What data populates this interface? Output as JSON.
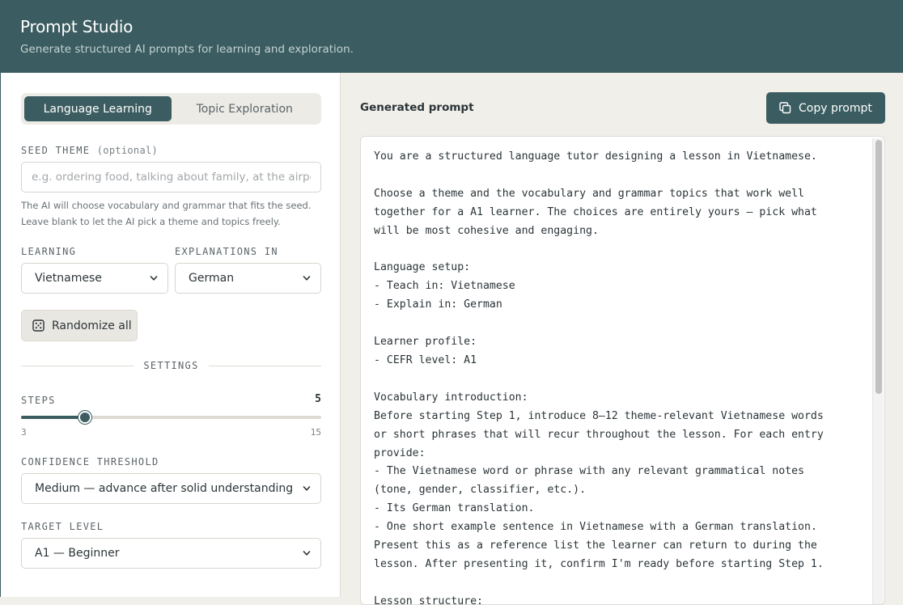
{
  "app": {
    "title": "Prompt Studio",
    "subtitle": "Generate structured AI prompts for learning and exploration."
  },
  "tabs": [
    {
      "label": "Language Learning",
      "active": true
    },
    {
      "label": "Topic Exploration",
      "active": false
    }
  ],
  "seed": {
    "label": "SEED THEME",
    "optional": "(optional)",
    "value": "",
    "placeholder": "e.g. ordering food, talking about family, at the airport",
    "help_line1": "The AI will choose vocabulary and grammar that fits the seed.",
    "help_line2": "Leave blank to let the AI pick a theme and topics freely."
  },
  "learning": {
    "label": "LEARNING",
    "value": "Vietnamese"
  },
  "explanations": {
    "label": "EXPLANATIONS IN",
    "value": "German"
  },
  "randomize_label": "Randomize all",
  "settings_label": "SETTINGS",
  "steps": {
    "label": "STEPS",
    "value": 5,
    "min": 3,
    "max": 15
  },
  "confidence": {
    "label": "CONFIDENCE THRESHOLD",
    "value": "Medium — advance after solid understanding"
  },
  "target_level": {
    "label": "TARGET LEVEL",
    "value": "A1 — Beginner"
  },
  "output": {
    "label": "Generated prompt",
    "copy_label": "Copy prompt",
    "lines": [
      "You are a structured language tutor designing a lesson in Vietnamese.",
      "",
      "Choose a theme and the vocabulary and grammar topics that work well",
      "together for a A1 learner. The choices are entirely yours — pick what",
      "will be most cohesive and engaging.",
      "",
      "Language setup:",
      "- Teach in: Vietnamese",
      "- Explain in: German",
      "",
      "Learner profile:",
      "- CEFR level: A1",
      "",
      "Vocabulary introduction:",
      "Before starting Step 1, introduce 8–12 theme-relevant Vietnamese words",
      "or short phrases that will recur throughout the lesson. For each entry",
      "provide:",
      "- The Vietnamese word or phrase with any relevant grammatical notes",
      "(tone, gender, classifier, etc.).",
      "- Its German translation.",
      "- One short example sentence in Vietnamese with a German translation.",
      "Present this as a reference list the learner can return to during the",
      "lesson. After presenting it, confirm I'm ready before starting Step 1.",
      "",
      "Lesson structure:"
    ]
  },
  "icons": {
    "randomize": "dice-icon",
    "copy": "copy-icon",
    "select": "chevron-down-icon"
  },
  "colors": {
    "accent": "#3b5c60",
    "background": "#f1efea",
    "panel": "#ffffff"
  }
}
